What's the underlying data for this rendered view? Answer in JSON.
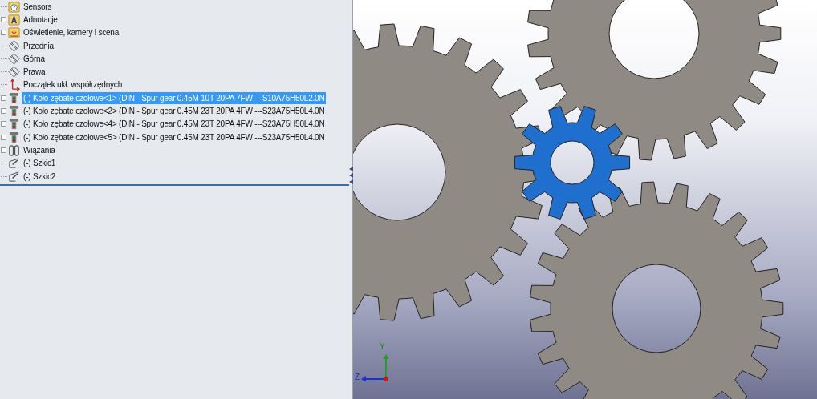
{
  "tree": {
    "items": [
      {
        "kind": "sensors",
        "label": "Sensors",
        "expandable": false,
        "selected": false
      },
      {
        "kind": "annotations",
        "label": "Adnotacje",
        "expandable": true,
        "selected": false
      },
      {
        "kind": "lights",
        "label": "Oświetlenie, kamery i scena",
        "expandable": true,
        "selected": false
      },
      {
        "kind": "plane",
        "label": "Przednia",
        "expandable": false,
        "selected": false
      },
      {
        "kind": "plane",
        "label": "Górna",
        "expandable": false,
        "selected": false
      },
      {
        "kind": "plane",
        "label": "Prawa",
        "expandable": false,
        "selected": false
      },
      {
        "kind": "origin",
        "label": "Początek ukł. współrzędnych",
        "expandable": false,
        "selected": false
      },
      {
        "kind": "part",
        "label": "(-) Koło zębate czołowe<1> (DIN - Spur gear 0.45M 10T 20PA 7FW ---S10A75H50L2.0N",
        "expandable": true,
        "selected": true
      },
      {
        "kind": "part",
        "label": "(-) Koło zębate czołowe<2> (DIN - Spur gear 0.45M 23T 20PA 4FW ---S23A75H50L4.0N",
        "expandable": true,
        "selected": false
      },
      {
        "kind": "part",
        "label": "(-) Koło zębate czołowe<4> (DIN - Spur gear 0.45M 23T 20PA 4FW ---S23A75H50L4.0N",
        "expandable": true,
        "selected": false
      },
      {
        "kind": "part",
        "label": "(-) Koło zębate czołowe<5> (DIN - Spur gear 0.45M 23T 20PA 4FW ---S23A75H50L4.0N",
        "expandable": true,
        "selected": false
      },
      {
        "kind": "mates",
        "label": "Wiązania",
        "expandable": true,
        "selected": false
      },
      {
        "kind": "sketch",
        "label": "(-) Szkic1",
        "expandable": false,
        "selected": false
      },
      {
        "kind": "sketch",
        "label": "(-) Szkic2",
        "expandable": false,
        "selected": false
      }
    ]
  },
  "triad": {
    "y_label": "Y",
    "z_label": "Z"
  }
}
